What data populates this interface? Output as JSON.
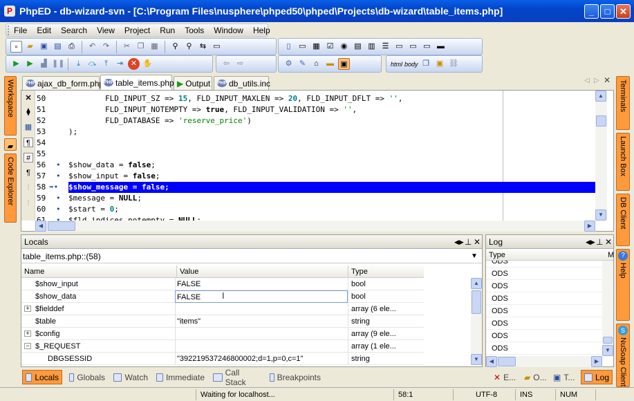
{
  "window": {
    "title": "PhpED - db-wizard-svn - [C:\\Program Files\\nusphere\\phped50\\phped\\Projects\\db-wizard\\table_items.php]",
    "minimize_label": "_",
    "maximize_label": "□",
    "close_label": "✕"
  },
  "menu": [
    "File",
    "Edit",
    "Search",
    "View",
    "Project",
    "Run",
    "Tools",
    "Window",
    "Help"
  ],
  "tabs": [
    {
      "label": "ajax_db_form.php"
    },
    {
      "label": "table_items.php"
    },
    {
      "label": "Output"
    },
    {
      "label": "db_utils.inc"
    }
  ],
  "left_panels": {
    "workspace": "Workspace",
    "code_explorer": "Code Explorer"
  },
  "right_panels": {
    "terminals": "Terminals",
    "launch_box": "Launch Box",
    "db_client": "DB Client",
    "help": "Help",
    "nusoap": "NuSoap Client"
  },
  "editor": {
    "lines": [
      {
        "n": "50",
        "mark": "",
        "code": "        FLD_INPUT_SZ => 15, FLD_INPUT_MAXLEN => 20, FLD_INPUT_DFLT => '',"
      },
      {
        "n": "51",
        "mark": "",
        "code": "        FLD_INPUT_NOTEMPTY => true, FLD_INPUT_VALIDATION => '',"
      },
      {
        "n": "52",
        "mark": "",
        "code": "        FLD_DATABASE => 'reserve_price')"
      },
      {
        "n": "53",
        "mark": "",
        "code": ");"
      },
      {
        "n": "54",
        "mark": "",
        "code": ""
      },
      {
        "n": "55",
        "mark": "",
        "code": ""
      },
      {
        "n": "56",
        "mark": "•",
        "code": "$show_data = false;"
      },
      {
        "n": "57",
        "mark": "•",
        "code": "$show_input = false;"
      },
      {
        "n": "58",
        "mark": "➡•",
        "code": "$show_message = false;",
        "highlight": true
      },
      {
        "n": "59",
        "mark": "•",
        "code": "$message = NULL;"
      },
      {
        "n": "60",
        "mark": "•",
        "code": "$start = 0;"
      },
      {
        "n": "61",
        "mark": "•",
        "code": "$fld_indices_notempty = NULL;"
      }
    ]
  },
  "locals": {
    "title": "Locals",
    "context": "table_items.php::(58)",
    "columns": [
      "Name",
      "Value",
      "Type"
    ],
    "rows": [
      {
        "expander": "",
        "name": "$show_input",
        "value": "FALSE",
        "type": "bool"
      },
      {
        "expander": "",
        "name": "$show_data",
        "value": "FALSE",
        "type": "bool",
        "editing": true
      },
      {
        "expander": "+",
        "name": "$fielddef",
        "value": "",
        "type": "array (6 ele..."
      },
      {
        "expander": "",
        "name": "$table",
        "value": "\"items\"",
        "type": "string"
      },
      {
        "expander": "+",
        "name": "$config",
        "value": "",
        "type": "array (9 ele..."
      },
      {
        "expander": "−",
        "name": "$_REQUEST",
        "value": "",
        "type": "array (1 ele..."
      },
      {
        "expander": "",
        "name": "DBGSESSID",
        "value": "\"392219537246800002;d=1,p=0,c=1\"",
        "type": "string",
        "indent": true
      }
    ]
  },
  "log": {
    "title": "Log",
    "columns": [
      "Type",
      "M"
    ],
    "rows": [
      "ODS",
      "ODS",
      "ODS",
      "ODS",
      "ODS",
      "ODS",
      "ODS",
      "ODS"
    ]
  },
  "bottom_tabs": [
    {
      "label": "Locals",
      "active": true
    },
    {
      "label": "Globals"
    },
    {
      "label": "Watch"
    },
    {
      "label": "Immediate"
    },
    {
      "label": "Call Stack"
    },
    {
      "label": "Breakpoints"
    }
  ],
  "log_tabs": [
    "E...",
    "O...",
    "T...",
    "Log"
  ],
  "status": {
    "message": "Waiting for localhost...",
    "position": "58:1",
    "encoding": "UTF-8",
    "ins": "INS",
    "num": "NUM"
  }
}
